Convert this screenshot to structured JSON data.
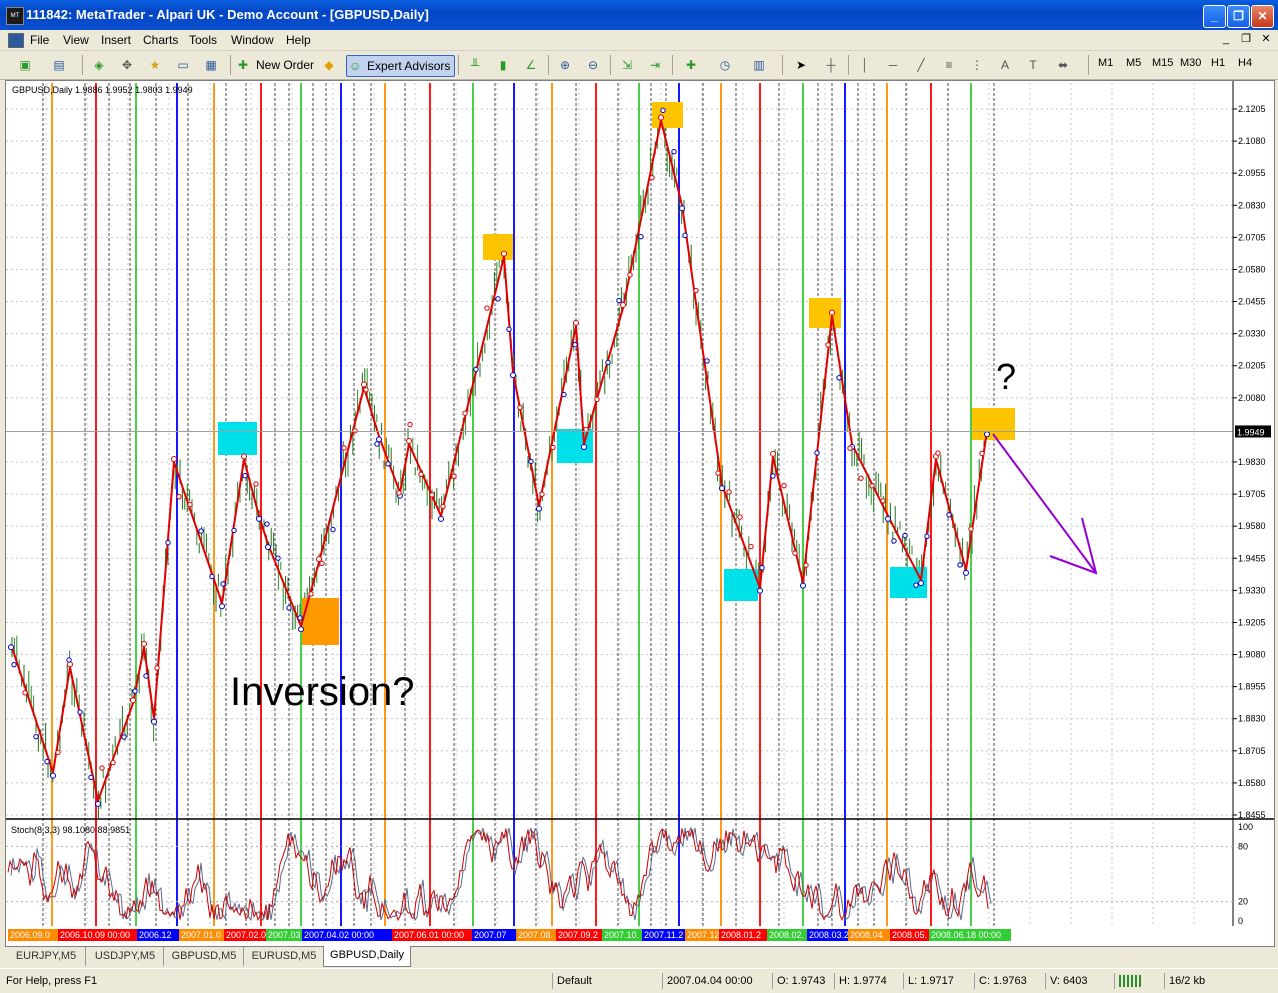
{
  "window": {
    "app_icon": "metatrader-icon",
    "title": "111842: MetaTrader - Alpari UK - Demo Account - [GBPUSD,Daily]",
    "controls": [
      "minimize-icon",
      "maximize-icon",
      "close-icon"
    ]
  },
  "menu": {
    "items": [
      "File",
      "View",
      "Insert",
      "Charts",
      "Tools",
      "Window",
      "Help"
    ],
    "mdi_controls": [
      "_",
      "❐",
      "✕"
    ]
  },
  "toolbar": {
    "new_order": "New Order",
    "expert_advisors": "Expert Advisors",
    "timeframes": [
      "M1",
      "M5",
      "M15",
      "M30",
      "H1",
      "H4"
    ]
  },
  "chart": {
    "header": "GBPUSD,Daily  1.9886 1.9952 1.9803 1.9949",
    "current_price": "1.9949",
    "price_labels": [
      "2.1205",
      "2.1080",
      "2.0955",
      "2.0830",
      "2.0705",
      "2.0580",
      "2.0455",
      "2.0330",
      "2.0205",
      "2.0080",
      "1.9830",
      "1.9705",
      "1.9580",
      "1.9455",
      "1.9330",
      "1.9205",
      "1.9080",
      "1.8955",
      "1.8830",
      "1.8705",
      "1.8580",
      "1.8455"
    ],
    "annotation_inversion": "Inversion?",
    "annotation_question": "?",
    "indicator_header": "Stoch(8,3,3) 98.1080 88.9851",
    "indicator_scale": [
      "100",
      "80",
      "20",
      "0"
    ],
    "date_labels": [
      {
        "text": "2006.09.0",
        "bg": "#ff8c00"
      },
      {
        "text": "2006.10.09 00:00",
        "bg": "#ff0000"
      },
      {
        "text": "2006.12",
        "bg": "#0000ff"
      },
      {
        "text": "2007.01.0",
        "bg": "#ff8c00"
      },
      {
        "text": "2007.02.0",
        "bg": "#ff0000"
      },
      {
        "text": "2007.03",
        "bg": "#32cd32"
      },
      {
        "text": "2007.04.02 00:00",
        "bg": "#0000ff"
      },
      {
        "text": "2007.06.01 00:00",
        "bg": "#ff0000"
      },
      {
        "text": "2007.07",
        "bg": "#0000ff"
      },
      {
        "text": "2007.08.",
        "bg": "#ff8c00"
      },
      {
        "text": "2007.09.2",
        "bg": "#ff0000"
      },
      {
        "text": "2007.10.",
        "bg": "#32cd32"
      },
      {
        "text": "2007.11.2",
        "bg": "#0000ff"
      },
      {
        "text": "2007.12.",
        "bg": "#ff8c00"
      },
      {
        "text": "2008.01.2",
        "bg": "#ff0000"
      },
      {
        "text": "2008.02.",
        "bg": "#32cd32"
      },
      {
        "text": "2008.03.2",
        "bg": "#0000ff"
      },
      {
        "text": "2008.04.",
        "bg": "#ff8c00"
      },
      {
        "text": "2008.05.",
        "bg": "#ff0000"
      },
      {
        "text": "2008.06.18 00:00",
        "bg": "#32cd32"
      }
    ],
    "colors": {
      "zigzag": "#e00000",
      "bars": "#2e8b2e",
      "highlight_top": "#ffc400",
      "highlight_bottom": "#00e0e8",
      "inversion_box": "#ff9900",
      "arrow": "#9400d3",
      "stoch_main": "#cc0000",
      "stoch_signal": "#5b6b8c"
    }
  },
  "chart_data": {
    "type": "line",
    "symbol": "GBPUSD",
    "timeframe": "Daily",
    "title": "GBPUSD,Daily",
    "ylim": [
      1.8455,
      2.1205
    ],
    "zigzag": {
      "name": "",
      "x": [
        "2006.08",
        "2006.09",
        "2006.10",
        "2006.10",
        "2006.11",
        "2006.11",
        "2006.12",
        "2006.12",
        "2007.01",
        "2007.01",
        "2007.02",
        "2007.02",
        "2007.03",
        "2007.03",
        "2007.04",
        "2007.04",
        "2007.05",
        "2007.05",
        "2007.06",
        "2007.06",
        "2007.07",
        "2007.08",
        "2007.08",
        "2007.09",
        "2007.09",
        "2007.10",
        "2007.11",
        "2007.12",
        "2008.01",
        "2008.01",
        "2008.02",
        "2008.02",
        "2008.03",
        "2008.04",
        "2008.05",
        "2008.05",
        "2008.06",
        "2008.06"
      ],
      "values": [
        1.912,
        1.862,
        1.903,
        1.851,
        1.889,
        1.911,
        1.883,
        1.983,
        1.928,
        1.984,
        1.962,
        1.951,
        1.919,
        1.944,
        2.012,
        1.993,
        1.971,
        1.99,
        1.962,
        2.063,
        2.018,
        1.966,
        2.036,
        1.99,
        2.043,
        2.116,
        2.083,
        1.974,
        1.934,
        1.985,
        1.936,
        2.04,
        1.99,
        1.962,
        1.937,
        1.984,
        1.941,
        1.995
      ]
    },
    "stochastic": {
      "k": 98.108,
      "d": 88.9851,
      "ylim": [
        0,
        100
      ],
      "levels": [
        80,
        20
      ]
    },
    "annotations": [
      "Inversion?",
      "?"
    ]
  },
  "tabs": [
    "EURJPY,M5",
    "USDJPY,M5",
    "GBPUSD,M5",
    "EURUSD,M5",
    "GBPUSD,Daily"
  ],
  "active_tab": "GBPUSD,Daily",
  "status": {
    "help": "For Help, press F1",
    "profile": "Default",
    "time": "2007.04.04 00:00",
    "open": "O: 1.9743",
    "high": "H: 1.9774",
    "low": "L: 1.9717",
    "close": "C: 1.9763",
    "volume": "V: 6403",
    "traffic": "16/2 kb"
  }
}
